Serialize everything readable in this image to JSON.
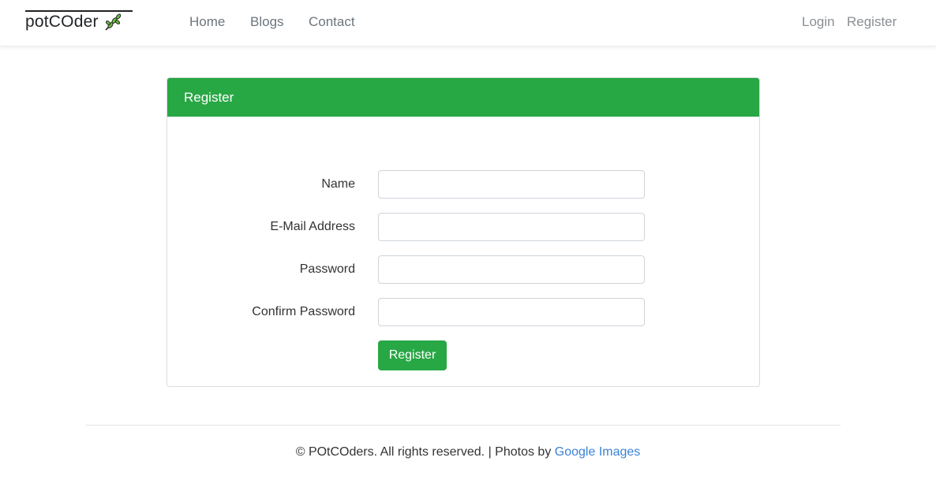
{
  "nav": {
    "brand": "potCOder",
    "brand_icon": "leaf-icon",
    "links": [
      "Home",
      "Blogs",
      "Contact"
    ],
    "right_links": [
      "Login",
      "Register"
    ]
  },
  "card": {
    "title": "Register",
    "fields": [
      {
        "label": "Name",
        "value": "",
        "placeholder": ""
      },
      {
        "label": "E-Mail Address",
        "value": "",
        "placeholder": ""
      },
      {
        "label": "Password",
        "value": "",
        "placeholder": ""
      },
      {
        "label": "Confirm Password",
        "value": "",
        "placeholder": ""
      }
    ],
    "submit_label": "Register"
  },
  "footer": {
    "text": "© POtCOders. All rights reserved. | Photos by",
    "link": "Google Images"
  },
  "colors": {
    "accent": "#28a745",
    "link": "#3b82d6"
  }
}
